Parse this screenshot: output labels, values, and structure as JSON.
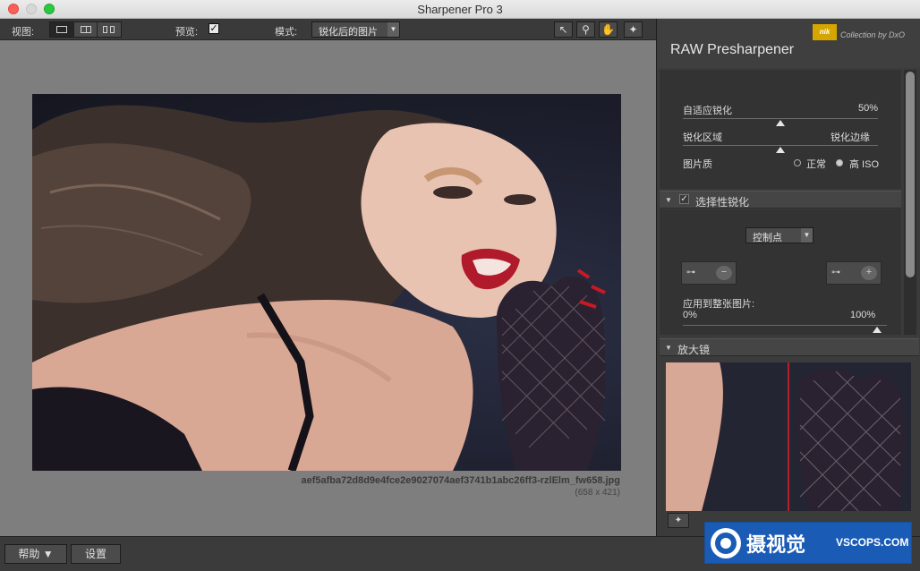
{
  "window": {
    "title": "Sharpener Pro 3"
  },
  "toolbar": {
    "view_label": "视图:",
    "preview_label": "预览:",
    "preview_checked": true,
    "mode_label": "模式:",
    "mode_value": "锐化后的图片",
    "view_modes": [
      "single",
      "split",
      "side-by-side"
    ],
    "tools": [
      "arrow-icon",
      "zoom-icon",
      "hand-icon",
      "color-picker-icon"
    ]
  },
  "image": {
    "filename": "aef5afba72d8d9e4fce2e9027074aef3741b1abc26ff3-rzlElm_fw658.jpg",
    "dimensions": "(658 x 421)"
  },
  "panel": {
    "brand": "nik",
    "brand_caption": "Collection by DxO",
    "title": "RAW Presharpener",
    "adaptive_label": "自适应锐化",
    "adaptive_value": "50%",
    "area_label": "锐化区域",
    "area_value": "锐化边缘",
    "quality_label": "图片质",
    "quality_options": [
      "正常",
      "高 ISO"
    ],
    "quality_selected": 1,
    "selective_header": "选择性锐化",
    "selective_checked": true,
    "control_points": "控制点",
    "apply_label": "应用到整张图片:",
    "apply_min": "0%",
    "apply_max": "100%",
    "loupe_header": "放大镜"
  },
  "statusbar": {
    "help_label": "帮助 ▼",
    "settings_label": "设置"
  },
  "watermark": {
    "cn": "摄视觉",
    "en": "VSCOPS.COM"
  },
  "colors": {
    "accent": "#d6a600",
    "panel_bg": "#3b3b3b",
    "canvas_bg": "#7e7e7e",
    "watermark_bg": "#1a5bb5"
  }
}
